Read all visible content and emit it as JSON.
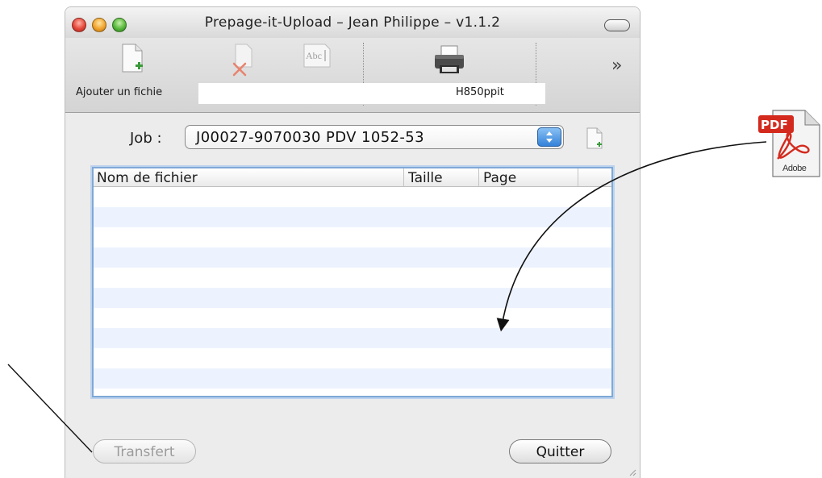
{
  "window": {
    "title": "Prepage-it-Upload – Jean Philippe – v1.1.2"
  },
  "toolbar": {
    "items": [
      {
        "label": "Ajouter un fichie",
        "icon": "add-file-icon"
      },
      {
        "label": "",
        "icon": "delete-icon"
      },
      {
        "label": "",
        "icon": "rename-icon"
      },
      {
        "label": "H850ppit",
        "icon": "printer-icon"
      }
    ],
    "overflow_icon": "chevron-double-right-icon",
    "overflow_glyph": "»"
  },
  "job": {
    "label": "Job :",
    "selected": "J00027-9070030 PDV 1052-53"
  },
  "table": {
    "columns": [
      "Nom de fichier",
      "Taille",
      "Page"
    ],
    "rows": []
  },
  "buttons": {
    "transfer": "Transfert",
    "quit": "Quitter"
  },
  "annotation": {
    "pdf_label": "PDF",
    "pdf_brand": "Adobe"
  },
  "colors": {
    "table_focus_ring": "#7fa8d6",
    "row_alternate": "#edf3fe",
    "pdf_red": "#d42a1e",
    "stepper_blue": "#2f7fd8"
  }
}
